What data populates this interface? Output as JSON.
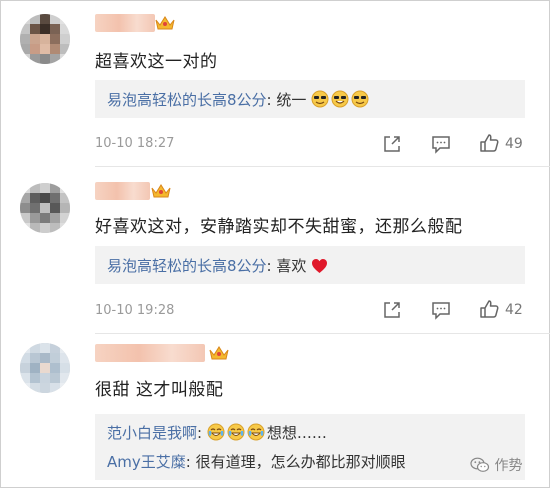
{
  "comments": [
    {
      "text": "超喜欢这一对的",
      "reply": {
        "user": "易泡高轻松的长高8公分",
        "sep": ":",
        "content": "统一",
        "emojis": [
          "sunglasses-emoji",
          "cool-smile-emoji",
          "sunglasses-emoji"
        ]
      },
      "time": "10-10 18:27",
      "likes": "49"
    },
    {
      "text": "好喜欢这对，安静踏实却不失甜蜜，还那么般配",
      "reply": {
        "user": "易泡高轻松的长高8公分",
        "sep": ":",
        "content": "喜欢",
        "emojis": [
          "red-heart-emoji"
        ]
      },
      "time": "10-10 19:28",
      "likes": "42"
    },
    {
      "text": "很甜 这才叫般配",
      "replies": [
        {
          "user": "范小白是我啊",
          "sep": ":",
          "content": "想想……",
          "emojis": [
            "tears-of-joy-emoji",
            "tears-of-joy-emoji",
            "tears-of-joy-emoji"
          ]
        },
        {
          "user": "Amy王艾糜",
          "sep": ":",
          "content": "很有道理，怎么办都比那对顺眼"
        }
      ]
    }
  ],
  "watermark": "作势",
  "colors": {
    "link": "#4a6fa5",
    "reply_bg": "#f2f2f2",
    "time": "#9a9a9a",
    "heart": "#e0182a"
  },
  "icons": [
    "share-icon",
    "comment-icon",
    "thumbs-up-icon",
    "vip-crown-icon",
    "wechat-icon"
  ]
}
